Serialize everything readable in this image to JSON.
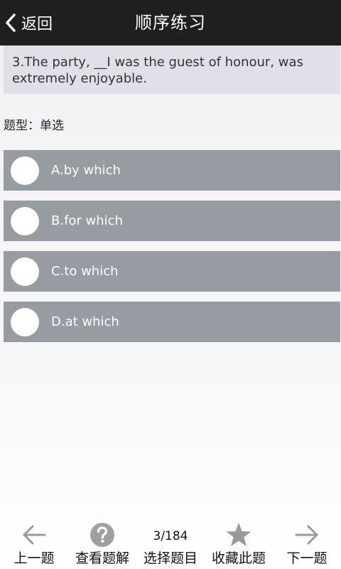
{
  "header": {
    "back_label": "返回",
    "title": "顺序练习"
  },
  "question": {
    "text": "3.The party, __I was the guest of honour, was extremely enjoyable.",
    "type_label": "题型：单选"
  },
  "options": [
    {
      "label": "A.by which"
    },
    {
      "label": "B.for which"
    },
    {
      "label": "C.to which"
    },
    {
      "label": "D.at which"
    }
  ],
  "bottom_nav": {
    "prev_label": "上一题",
    "explain_label": "查看题解",
    "select_label": "选择题目",
    "counter": "3/184",
    "favorite_label": "收藏此题",
    "next_label": "下一题"
  },
  "colors": {
    "header_bg": "#1f1f1f",
    "question_bg": "#dfe0e8",
    "option_bg": "#969ca2",
    "icon_gray": "#9a9a9a"
  }
}
